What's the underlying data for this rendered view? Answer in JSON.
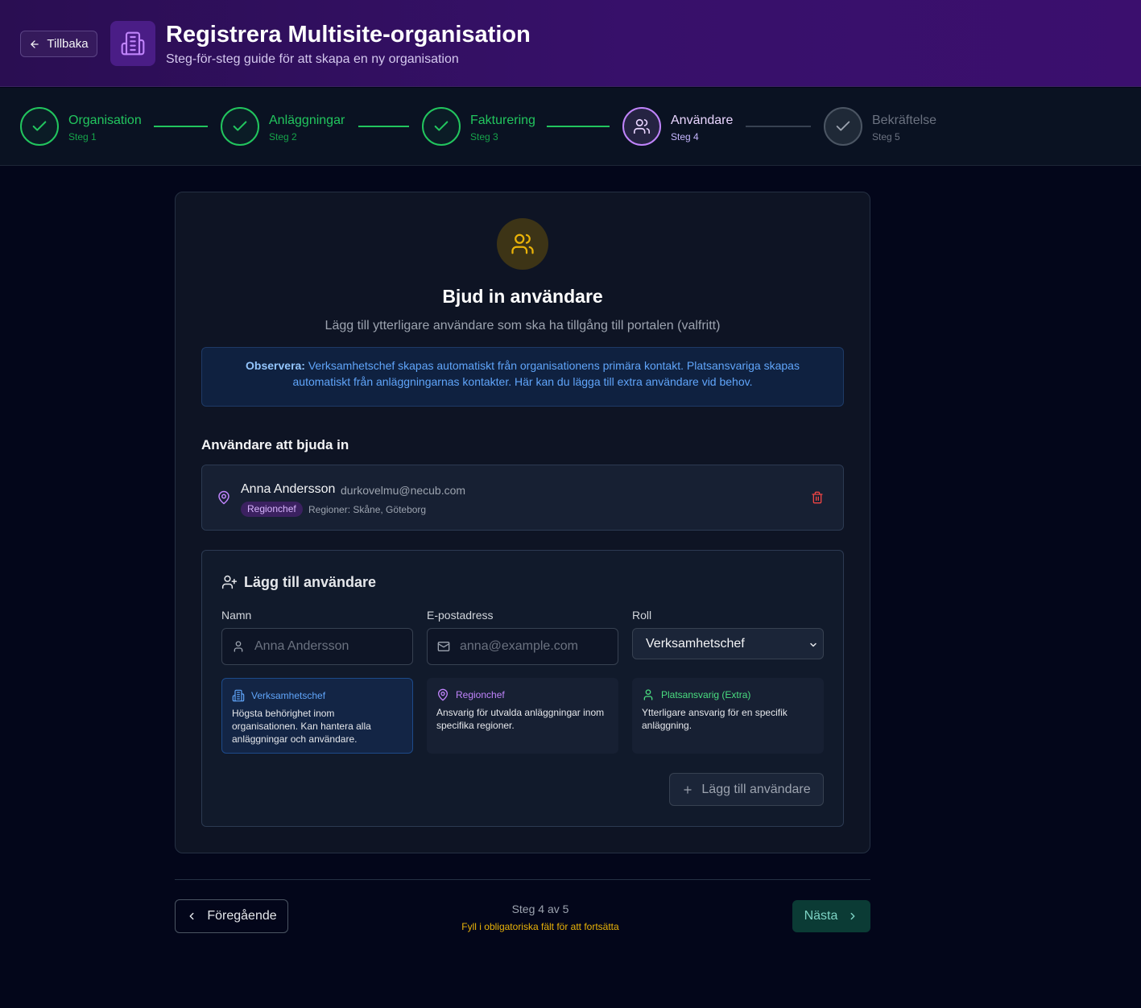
{
  "header": {
    "back_label": "Tillbaka",
    "title": "Registrera Multisite-organisation",
    "subtitle": "Steg-för-steg guide för att skapa en ny organisation"
  },
  "steps": [
    {
      "label": "Organisation",
      "number": "Steg 1",
      "status": "done"
    },
    {
      "label": "Anläggningar",
      "number": "Steg 2",
      "status": "done"
    },
    {
      "label": "Fakturering",
      "number": "Steg 3",
      "status": "done"
    },
    {
      "label": "Användare",
      "number": "Steg 4",
      "status": "active"
    },
    {
      "label": "Bekräftelse",
      "number": "Steg 5",
      "status": "pending"
    }
  ],
  "card": {
    "title": "Bjud in användare",
    "subtitle": "Lägg till ytterligare användare som ska ha tillgång till portalen (valfritt)",
    "notice_label": "Observera:",
    "notice_text": " Verksamhetschef skapas automatiskt från organisationens primära kontakt. Platsansvariga skapas automatiskt från anläggningarnas kontakter. Här kan du lägga till extra användare vid behov.",
    "invite_section_title": "Användare att bjuda in",
    "invitees": [
      {
        "name": "Anna Andersson",
        "email": "durkovelmu@necub.com",
        "role": "Regionchef",
        "regions": "Regioner: Skåne, Göteborg"
      }
    ]
  },
  "add_form": {
    "title": "Lägg till användare",
    "name_label": "Namn",
    "name_placeholder": "Anna Andersson",
    "email_label": "E-postadress",
    "email_placeholder": "anna@example.com",
    "role_label": "Roll",
    "role_selected": "Verksamhetschef",
    "roles": [
      {
        "name": "Verksamhetschef",
        "desc": "Högsta behörighet inom organisationen. Kan hantera alla anläggningar och användare.",
        "color": "#60a5fa",
        "icon": "building-icon"
      },
      {
        "name": "Regionchef",
        "desc": "Ansvarig för utvalda anläggningar inom specifika regioner.",
        "color": "#c084fc",
        "icon": "map-pin-icon"
      },
      {
        "name": "Platsansvarig (Extra)",
        "desc": "Ytterligare ansvarig för en specifik anläggning.",
        "color": "#4ade80",
        "icon": "user-icon"
      }
    ],
    "add_button": "Lägg till användare"
  },
  "footer": {
    "prev_label": "Föregående",
    "step_count": "Steg 4 av 5",
    "warning": "Fyll i obligatoriska fält för att fortsätta",
    "next_label": "Nästa"
  },
  "colors": {
    "done": "#22c55e",
    "active": "#c084fc",
    "pending": "#4b5563",
    "header_bg": "#2a0e52",
    "warning": "#eab308"
  }
}
